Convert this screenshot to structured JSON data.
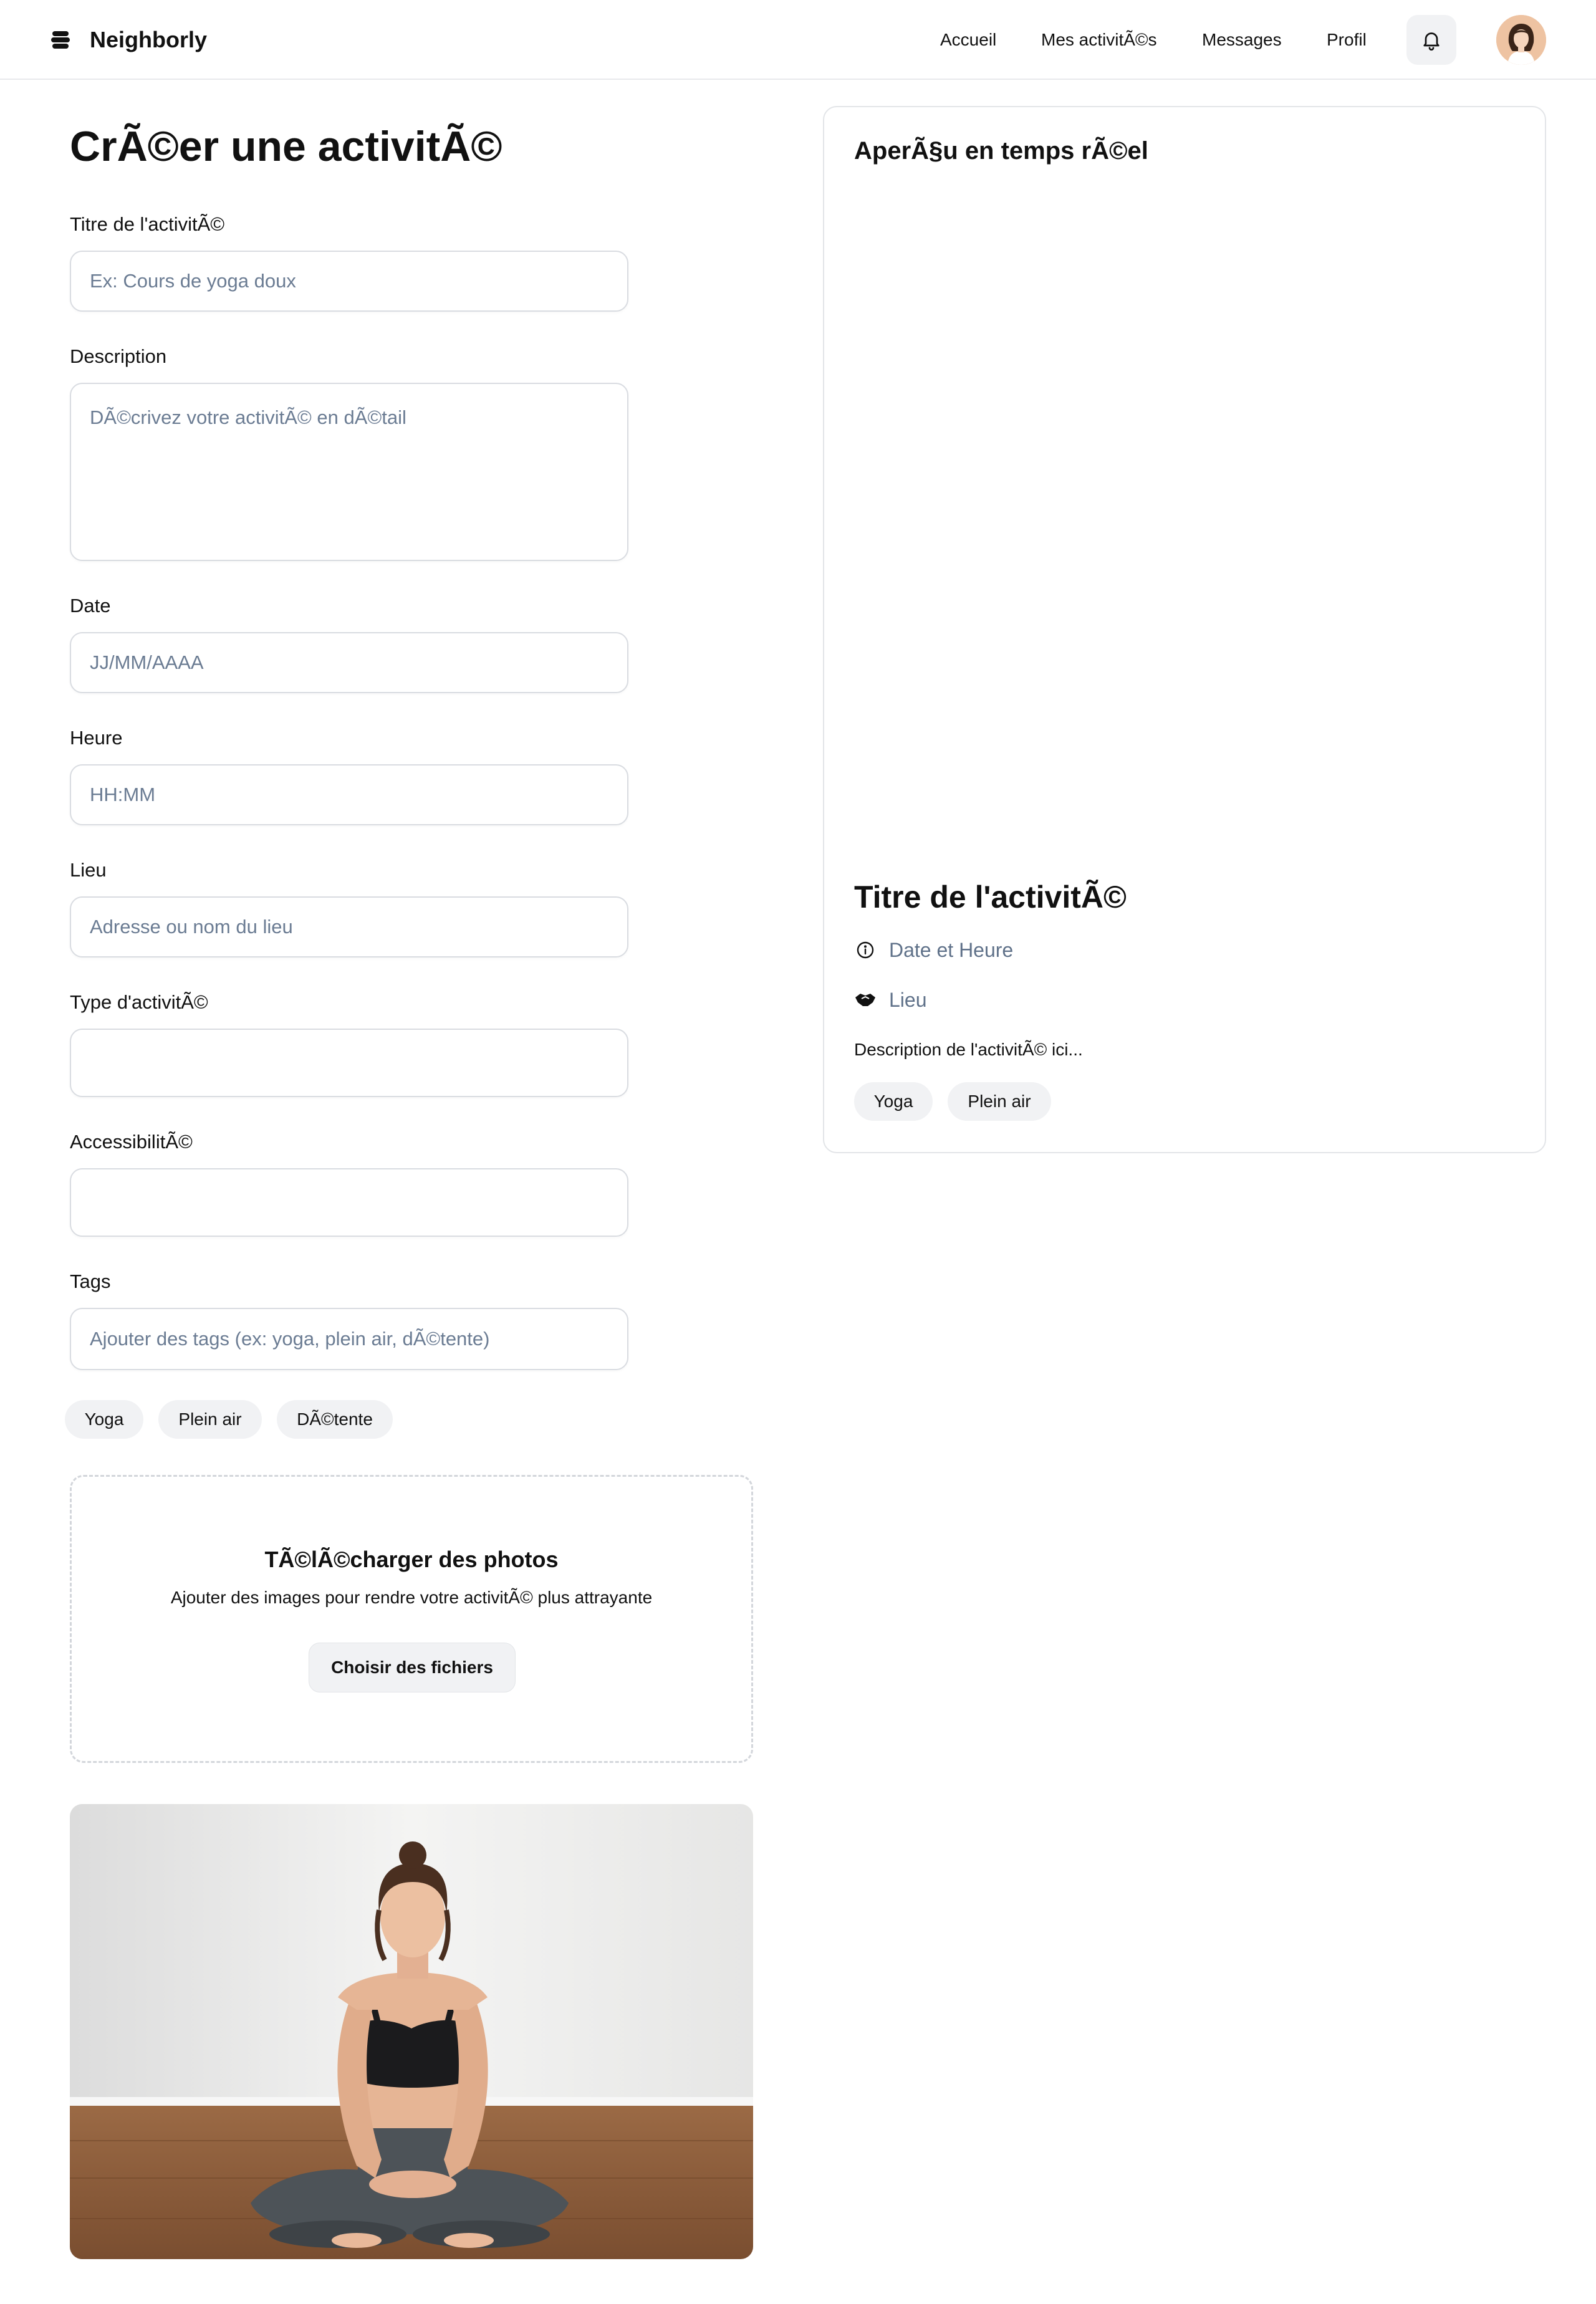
{
  "header": {
    "brand": "Neighborly",
    "nav": [
      "Accueil",
      "Mes activitÃ©s",
      "Messages",
      "Profil"
    ]
  },
  "form": {
    "page_title": "CrÃ©er une activitÃ©",
    "title_label": "Titre de l'activitÃ©",
    "title_placeholder": "Ex: Cours de yoga doux",
    "description_label": "Description",
    "description_placeholder": "DÃ©crivez votre activitÃ© en dÃ©tail",
    "date_label": "Date",
    "date_placeholder": "JJ/MM/AAAA",
    "time_label": "Heure",
    "time_placeholder": "HH:MM",
    "location_label": "Lieu",
    "location_placeholder": "Adresse ou nom du lieu",
    "type_label": "Type d'activitÃ©",
    "type_value": "",
    "accessibility_label": "AccessibilitÃ©",
    "accessibility_value": "",
    "tags_label": "Tags",
    "tags_placeholder": "Ajouter des tags (ex: yoga, plein air, dÃ©tente)",
    "tags": [
      "Yoga",
      "Plein air",
      "DÃ©tente"
    ]
  },
  "upload": {
    "title": "TÃ©lÃ©charger des photos",
    "subtitle": "Ajouter des images pour rendre votre activitÃ© plus attrayante",
    "button": "Choisir des fichiers"
  },
  "preview": {
    "heading": "AperÃ§u en temps rÃ©el",
    "title": "Titre de l'activitÃ©",
    "datetime": "Date et Heure",
    "location": "Lieu",
    "description": "Description de l'activitÃ© ici...",
    "tags": [
      "Yoga",
      "Plein air"
    ]
  },
  "colors": {
    "placeholder_text": "#6b7c93",
    "meta_text": "#5f7189",
    "chip_bg": "#f1f2f4",
    "border": "#d9dce1"
  },
  "icons": {
    "brand": "stack-logo-icon",
    "notifications": "bell-icon",
    "datetime": "info-circle-icon",
    "location": "handshake-icon"
  }
}
